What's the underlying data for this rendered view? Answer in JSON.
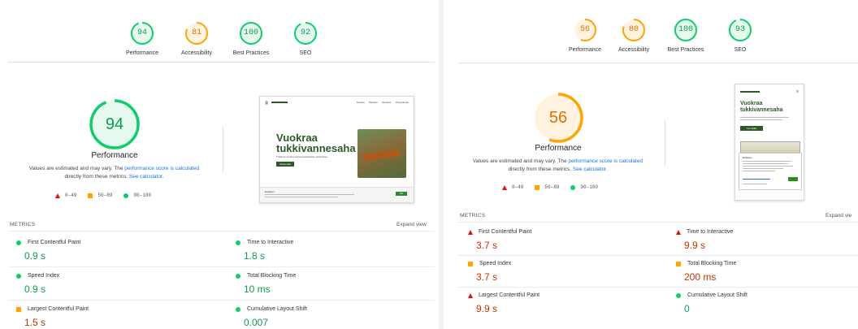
{
  "left": {
    "gauges": [
      {
        "value": "94",
        "label": "Performance",
        "color": "#0cce6b",
        "score": 0.94
      },
      {
        "value": "81",
        "label": "Accessibility",
        "color": "#ffa400",
        "score": 0.81
      },
      {
        "value": "100",
        "label": "Best Practices",
        "color": "#0cce6b",
        "score": 1.0
      },
      {
        "value": "92",
        "label": "SEO",
        "color": "#0cce6b",
        "score": 0.92
      }
    ],
    "main_score": {
      "value": "94",
      "label": "Performance",
      "score": 0.94,
      "color": "#0cce6b"
    },
    "desc_line1": "Values are estimated and may vary. The ",
    "desc_link1": "performance score is calculated",
    "desc_line2": "directly from these metrics. ",
    "desc_link2": "See calculator.",
    "legend": [
      "0–49",
      "50–89",
      "90–100"
    ],
    "preview": {
      "logo": "Ⓖ",
      "nav": [
        "Etusivu",
        "Palvelut",
        "Hinnasto",
        "Yhteystiedot"
      ],
      "headline_1": "Vuokraa",
      "headline_2": "tukkivannesaha",
      "sub": "Tukkivannesaha tarjoaa laadukkaan sahauksen",
      "cta": "Varaa aika",
      "cookie_title": "Evästeet",
      "cookie_btn": "OK"
    },
    "metrics_title": "METRICS",
    "expand_label": "Expand view",
    "metrics": [
      {
        "label": "First Contentful Paint",
        "value": "0.9 s",
        "status": "good"
      },
      {
        "label": "Time to Interactive",
        "value": "1.8 s",
        "status": "good"
      },
      {
        "label": "Speed Index",
        "value": "0.9 s",
        "status": "good"
      },
      {
        "label": "Total Blocking Time",
        "value": "10 ms",
        "status": "good"
      },
      {
        "label": "Largest Contentful Paint",
        "value": "1.5 s",
        "status": "average"
      },
      {
        "label": "Cumulative Layout Shift",
        "value": "0.007",
        "status": "good"
      }
    ]
  },
  "right": {
    "gauges": [
      {
        "value": "56",
        "label": "Performance",
        "color": "#ffa400",
        "score": 0.56
      },
      {
        "value": "80",
        "label": "Accessibility",
        "color": "#ffa400",
        "score": 0.8
      },
      {
        "value": "100",
        "label": "Best Practices",
        "color": "#0cce6b",
        "score": 1.0
      },
      {
        "value": "93",
        "label": "SEO",
        "color": "#0cce6b",
        "score": 0.93
      }
    ],
    "main_score": {
      "value": "56",
      "label": "Performance",
      "score": 0.56,
      "color": "#ffa400"
    },
    "desc_line1": "Values are estimated and may vary. The ",
    "desc_link1": "performance score is calculated",
    "desc_line2": "directly from these metrics. ",
    "desc_link2": "See calculator.",
    "legend": [
      "0–49",
      "50–89",
      "90–100"
    ],
    "preview": {
      "headline_1": "Vuokraa",
      "headline_2": "tukkivannesaha",
      "cta": "Lue lisää",
      "cookie_title": "Evästeet"
    },
    "metrics_title": "METRICS",
    "expand_label": "Expand vie",
    "metrics": [
      {
        "label": "First Contentful Paint",
        "value": "3.7 s",
        "status": "poor"
      },
      {
        "label": "Time to Interactive",
        "value": "9.9 s",
        "status": "poor"
      },
      {
        "label": "Speed Index",
        "value": "3.7 s",
        "status": "average"
      },
      {
        "label": "Total Blocking Time",
        "value": "200 ms",
        "status": "average"
      },
      {
        "label": "Largest Contentful Paint",
        "value": "9.9 s",
        "status": "poor"
      },
      {
        "label": "Cumulative Layout Shift",
        "value": "0",
        "status": "good"
      }
    ]
  },
  "colors": {
    "good": "#0cce6b",
    "average": "#ffa400",
    "poor": "#eb0f00",
    "link": "#1a73e8",
    "site_green": "#2d5a27"
  }
}
